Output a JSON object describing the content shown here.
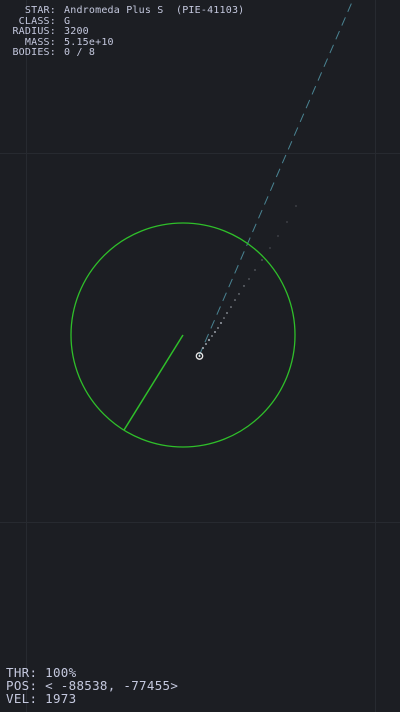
{
  "star_info": {
    "star_label": "STAR:",
    "star_value": "Andromeda Plus S  (PIE-41103)",
    "class_label": "CLASS:",
    "class_value": "G",
    "radius_label": "RADIUS:",
    "radius_value": "3200",
    "mass_label": "MASS:",
    "mass_value": "5.15e+10",
    "bodies_label": "BODIES:",
    "bodies_value": "0 / 8"
  },
  "ship_status": {
    "thr_label": "THR:",
    "thr_value": "100%",
    "pos_label": "POS:",
    "pos_value": "< -88538, -77455>",
    "vel_label": "VEL:",
    "vel_value": "1973"
  },
  "colors": {
    "background": "#1c1e23",
    "grid": "#2a2d33",
    "orbit": "#2fbf2a",
    "trajectory": "#4f8f9f",
    "hud_text": "#c4c8de",
    "ship": "#e8e8e8"
  },
  "icons": {
    "ship": "ship-icon",
    "orbit": "star-orbit-ring"
  },
  "thrust_level": 1.0
}
